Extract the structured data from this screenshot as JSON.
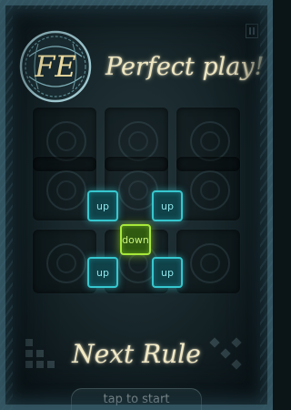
{
  "header": {
    "logo_text": "FE",
    "title": "Perfect play!"
  },
  "rule_tiles": [
    {
      "label": "up",
      "style": "cyan"
    },
    {
      "label": "up",
      "style": "cyan"
    },
    {
      "label": "down",
      "style": "green"
    },
    {
      "label": "up",
      "style": "cyan"
    },
    {
      "label": "up",
      "style": "cyan"
    }
  ],
  "next_rule_label": "Next Rule",
  "start_label": "tap to start",
  "colors": {
    "title": "#f0e7c0",
    "tile_cyan": "#36c7cf",
    "tile_green": "#a7e83a",
    "background": "#17262a"
  }
}
